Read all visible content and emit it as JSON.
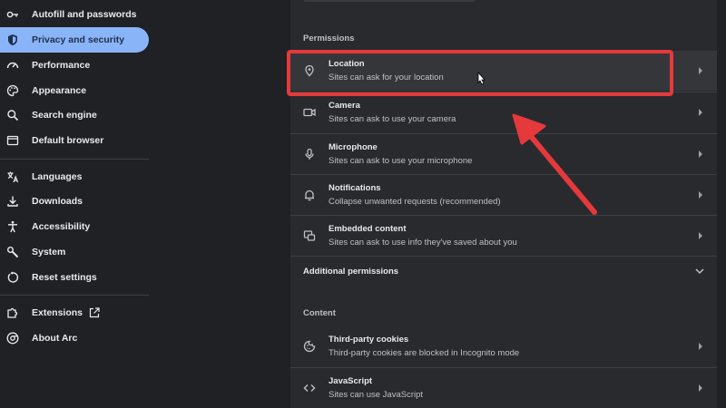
{
  "sidebar": {
    "items": [
      {
        "label": "Autofill and passwords",
        "icon": "key-icon",
        "active": false
      },
      {
        "label": "Privacy and security",
        "icon": "shield-icon",
        "active": true
      },
      {
        "label": "Performance",
        "icon": "gauge-icon",
        "active": false
      },
      {
        "label": "Appearance",
        "icon": "palette-icon",
        "active": false
      },
      {
        "label": "Search engine",
        "icon": "search-icon",
        "active": false
      },
      {
        "label": "Default browser",
        "icon": "browser-icon",
        "active": false
      },
      {
        "label": "Languages",
        "icon": "translate-icon",
        "active": false
      },
      {
        "label": "Downloads",
        "icon": "download-icon",
        "active": false
      },
      {
        "label": "Accessibility",
        "icon": "accessibility-icon",
        "active": false
      },
      {
        "label": "System",
        "icon": "wrench-icon",
        "active": false
      },
      {
        "label": "Reset settings",
        "icon": "reset-icon",
        "active": false
      },
      {
        "label": "Extensions",
        "icon": "puzzle-icon",
        "active": false
      },
      {
        "label": "About Arc",
        "icon": "chrome-icon",
        "active": false
      }
    ]
  },
  "permissions": {
    "title": "Permissions",
    "rows": [
      {
        "title": "Location",
        "subtitle": "Sites can ask for your location",
        "icon": "location-pin-icon"
      },
      {
        "title": "Camera",
        "subtitle": "Sites can ask to use your camera",
        "icon": "camera-icon"
      },
      {
        "title": "Microphone",
        "subtitle": "Sites can ask to use your microphone",
        "icon": "microphone-icon"
      },
      {
        "title": "Notifications",
        "subtitle": "Collapse unwanted requests (recommended)",
        "icon": "bell-icon"
      },
      {
        "title": "Embedded content",
        "subtitle": "Sites can ask to use info they've saved about you",
        "icon": "embedded-content-icon"
      }
    ],
    "additional": "Additional permissions"
  },
  "content": {
    "title": "Content",
    "rows": [
      {
        "title": "Third-party cookies",
        "subtitle": "Third-party cookies are blocked in Incognito mode",
        "icon": "cookie-icon"
      },
      {
        "title": "JavaScript",
        "subtitle": "Sites can use JavaScript",
        "icon": "code-icon"
      }
    ]
  },
  "colors": {
    "accent": "#8ab4f8",
    "annotation": "#e5393b"
  }
}
